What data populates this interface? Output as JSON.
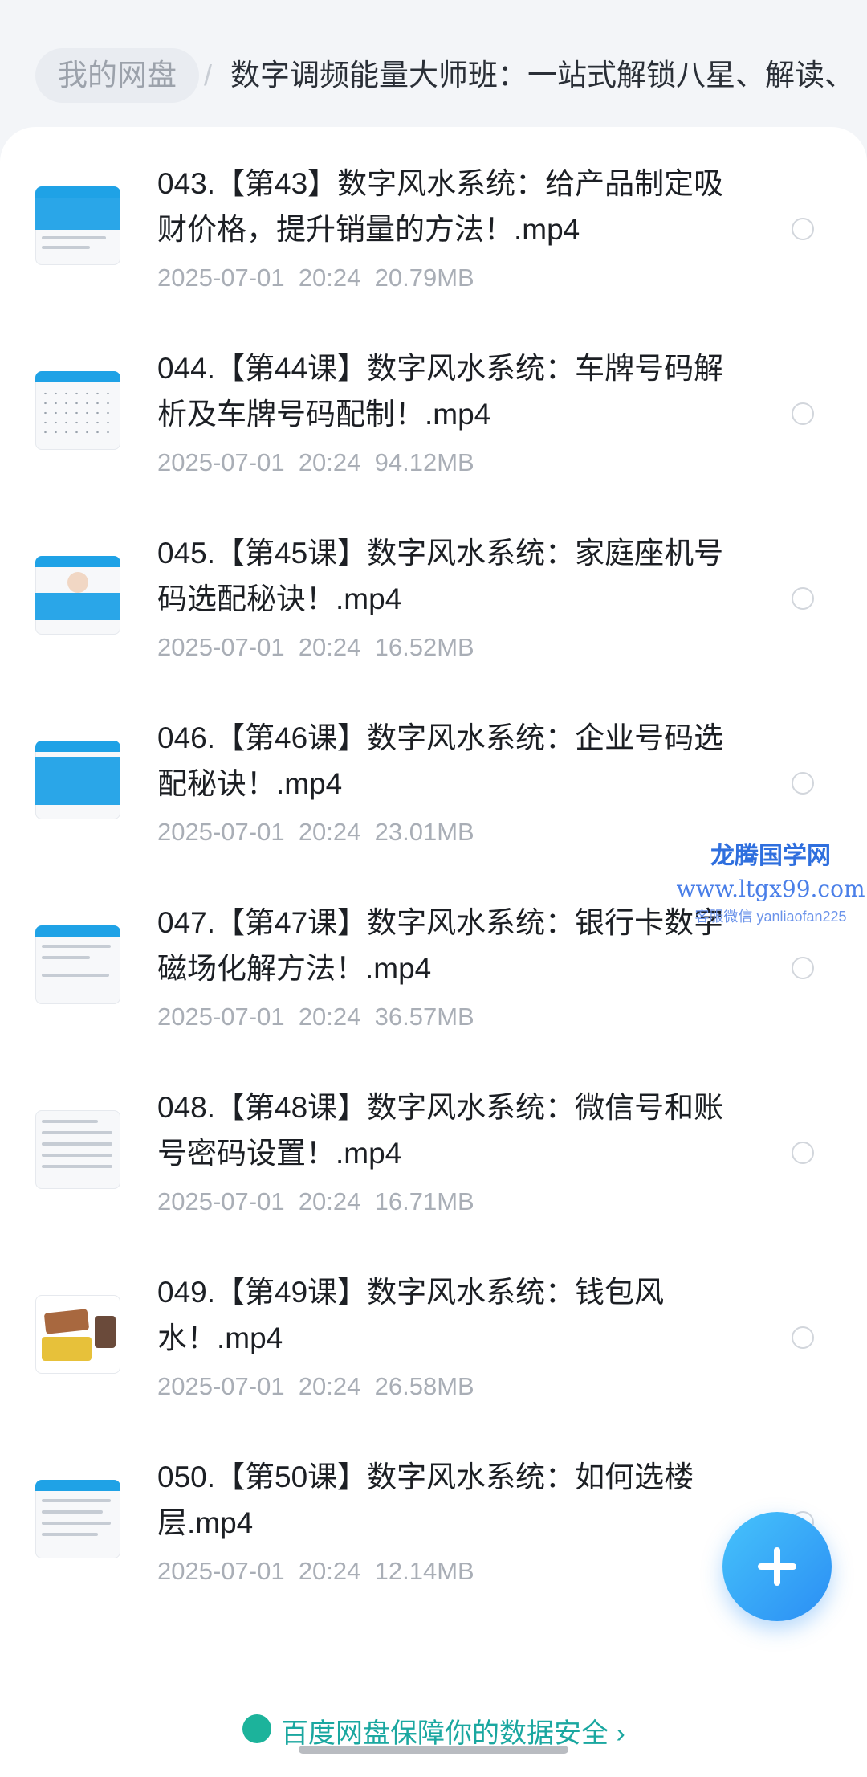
{
  "breadcrumb": {
    "home": "我的网盘",
    "separator": "/",
    "current": "数字调频能量大师班：一站式解锁八星、解读、"
  },
  "files": [
    {
      "title": "043.【第43】数字风水系统：给产品制定吸财价格，提升销量的方法！.mp4",
      "date": "2025-07-01",
      "time": "20:24",
      "size": "20.79MB",
      "thumb": "banner"
    },
    {
      "title": "044.【第44课】数字风水系统：车牌号码解析及车牌号码配制！.mp4",
      "date": "2025-07-01",
      "time": "20:24",
      "size": "94.12MB",
      "thumb": "grid"
    },
    {
      "title": "045.【第45课】数字风水系统：家庭座机号码选配秘诀！.mp4",
      "date": "2025-07-01",
      "time": "20:24",
      "size": "16.52MB",
      "thumb": "person"
    },
    {
      "title": "046.【第46课】数字风水系统：企业号码选配秘诀！.mp4",
      "date": "2025-07-01",
      "time": "20:24",
      "size": "23.01MB",
      "thumb": "bluebox"
    },
    {
      "title": "047.【第47课】数字风水系统：银行卡数字磁场化解方法！.mp4",
      "date": "2025-07-01",
      "time": "20:24",
      "size": "36.57MB",
      "thumb": "text"
    },
    {
      "title": "048.【第48课】数字风水系统：微信号和账号密码设置！.mp4",
      "date": "2025-07-01",
      "time": "20:24",
      "size": "16.71MB",
      "thumb": "text"
    },
    {
      "title": "049.【第49课】数字风水系统：钱包风水！.mp4",
      "date": "2025-07-01",
      "time": "20:24",
      "size": "26.58MB",
      "thumb": "wallets"
    },
    {
      "title": "050.【第50课】数字风水系统：如何选楼层.mp4",
      "date": "2025-07-01",
      "time": "20:24",
      "size": "12.14MB",
      "thumb": "text"
    }
  ],
  "watermark": {
    "site_name": "龙腾国学网",
    "url": "www.ltgx99.com",
    "contact": "客服微信 yanliaofan225"
  },
  "fab_icon": "plus-icon",
  "notice_text": "百度网盘保障你的数据安全 ›",
  "colors": {
    "accent": "#2b8ef4",
    "title": "#1c1f24",
    "meta": "#a9aeb6",
    "background": "#f3f5f8"
  }
}
